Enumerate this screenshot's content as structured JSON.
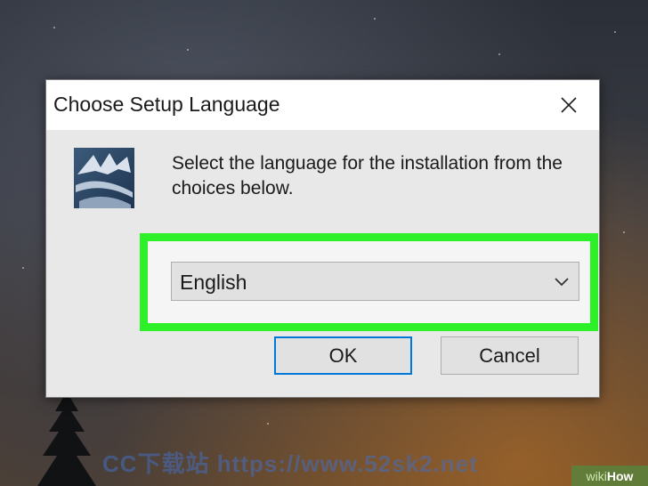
{
  "dialog": {
    "title": "Choose Setup Language",
    "close_icon": "close-icon",
    "instruction": "Select the language for the installation from the choices below.",
    "language_select": {
      "selected": "English",
      "chevron_icon": "chevron-down-icon"
    },
    "ok_label": "OK",
    "cancel_label": "Cancel",
    "highlight_color": "#2ef028",
    "focus_color": "#0078d7"
  },
  "overlay": {
    "watermark": "CC下载站 https://www.52sk2.net",
    "brand_prefix": "wiki",
    "brand_suffix": "How"
  }
}
